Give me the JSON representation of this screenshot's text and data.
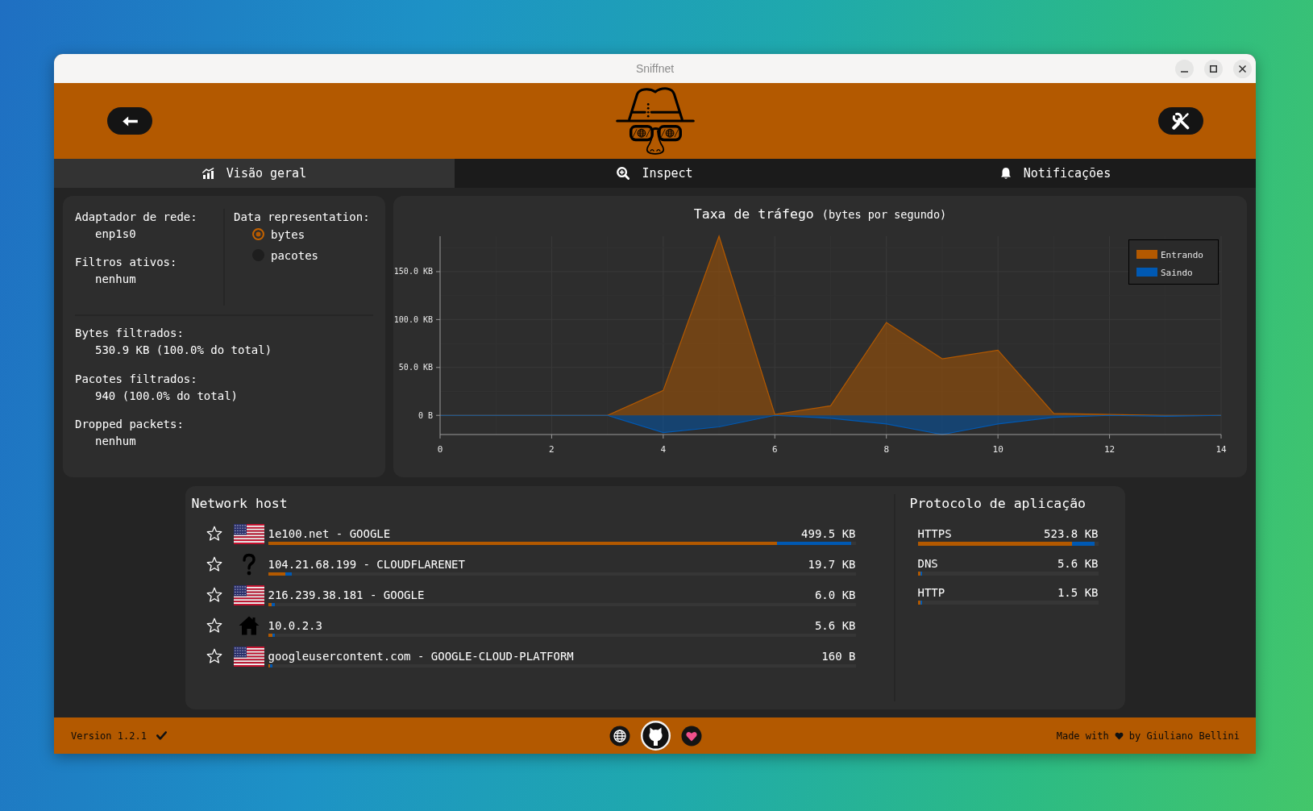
{
  "window": {
    "title": "Sniffnet"
  },
  "tabs": [
    {
      "kind": "overview",
      "label": "Visão geral",
      "selected": true
    },
    {
      "kind": "inspect",
      "label": "Inspect",
      "selected": false
    },
    {
      "kind": "notifications",
      "label": "Notificações",
      "selected": false
    }
  ],
  "overview": {
    "info": [
      {
        "label": "Adaptador de rede:",
        "value": "enp1s0"
      },
      {
        "label": "Filtros ativos:",
        "value": "nenhum"
      }
    ],
    "data_representation": {
      "label": "Data representation:",
      "options": [
        {
          "label": "bytes",
          "selected": true
        },
        {
          "label": "pacotes",
          "selected": false
        }
      ]
    },
    "stats": [
      {
        "label": "Bytes filtrados:",
        "value": "530.9 KB (100.0% do total)"
      },
      {
        "label": "Pacotes filtrados:",
        "value": "940 (100.0% do total)"
      },
      {
        "label": "Dropped packets:",
        "value": "nenhum"
      }
    ]
  },
  "traffic_chart": {
    "subtitle": "(bytes por segundo)",
    "chart_data": {
      "type": "area",
      "title": "Taxa de tráfego",
      "x": [
        0,
        1,
        2,
        3,
        4,
        5,
        6,
        7,
        8,
        9,
        10,
        11,
        12,
        13,
        14
      ],
      "series": [
        {
          "name": "Entrando",
          "color": "#b35900",
          "values": [
            0,
            0,
            0,
            0,
            26,
            187,
            1,
            10,
            97,
            59,
            68,
            2,
            1,
            0,
            0
          ]
        },
        {
          "name": "Saindo",
          "color": "#0059b3",
          "values": [
            0,
            0,
            0,
            0,
            -18,
            -12,
            0,
            -3,
            -9,
            -20,
            -9,
            -2,
            0,
            -1,
            0
          ]
        }
      ],
      "xlim": [
        0,
        14
      ],
      "ylim": [
        -20,
        187
      ],
      "xticks": [
        0,
        2,
        4,
        6,
        8,
        10,
        12,
        14
      ],
      "yticks": [
        {
          "value": 0,
          "label": "0 B"
        },
        {
          "value": 50,
          "label": "50.0 KB"
        },
        {
          "value": 100,
          "label": "100.0 KB"
        },
        {
          "value": 150,
          "label": "150.0 KB"
        }
      ],
      "grid": true,
      "legend": "upper right"
    }
  },
  "network_hosts": {
    "title": "Network host",
    "rows": [
      {
        "kind": "flag",
        "name": "1e100.net - GOOGLE",
        "amount": "499.5 KB",
        "favorite": false,
        "incoming": {
          "level": 0.866
        },
        "outgoing": {
          "level": 0.126
        }
      },
      {
        "kind": "unknown",
        "name": "104.21.68.199 - CLOUDFLARENET",
        "amount": "19.7 KB",
        "favorite": false,
        "incoming": {
          "level": 0.029
        },
        "outgoing": {
          "level": 0.011
        }
      },
      {
        "kind": "flag",
        "name": "216.239.38.181 - GOOGLE",
        "amount": "6.0 KB",
        "favorite": false,
        "incoming": {
          "level": 0.006
        },
        "outgoing": {
          "level": 0.006
        }
      },
      {
        "kind": "home",
        "name": "10.0.2.3",
        "amount": "5.6 KB",
        "favorite": false,
        "incoming": {
          "level": 0.007
        },
        "outgoing": {
          "level": 0.005
        }
      },
      {
        "kind": "flag",
        "name": "googleusercontent.com - GOOGLE-CLOUD-PLATFORM",
        "amount": "160 B",
        "favorite": false,
        "incoming": {
          "level": 0.004
        },
        "outgoing": {
          "level": 0.004
        }
      }
    ]
  },
  "protocols": {
    "title": "Protocolo de aplicação",
    "rows": [
      {
        "name": "HTTPS",
        "amount": "523.8 KB",
        "incoming": {
          "level": 0.853
        },
        "outgoing": {
          "level": 0.129
        }
      },
      {
        "name": "DNS",
        "amount": "5.6 KB",
        "incoming": {
          "level": 0.015
        },
        "outgoing": {
          "level": 0.01
        }
      },
      {
        "name": "HTTP",
        "amount": "1.5 KB",
        "incoming": {
          "level": 0.015
        },
        "outgoing": {
          "level": 0.01
        }
      }
    ]
  },
  "footer": {
    "version": "Version 1.2.1",
    "up_to_date": true,
    "made_with": "Made with",
    "author": "by Giuliano Bellini"
  }
}
